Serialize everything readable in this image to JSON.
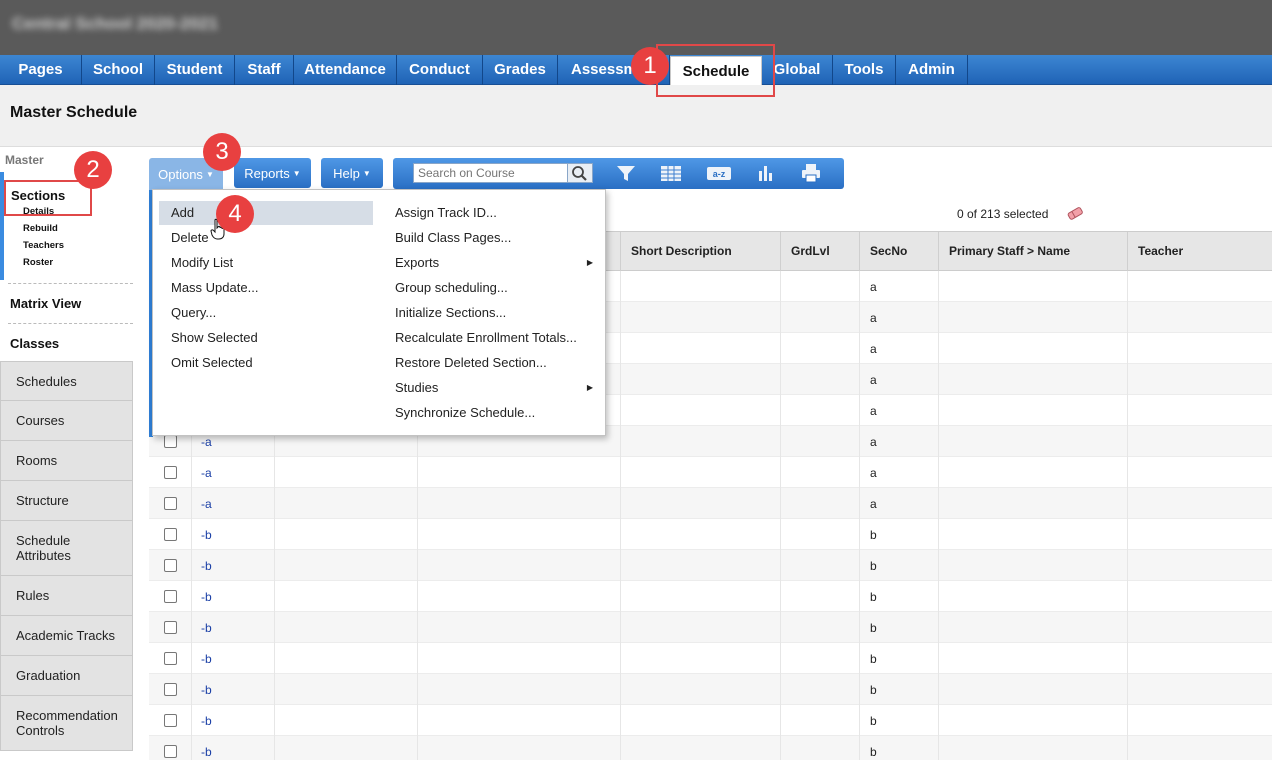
{
  "school_name": "Central School 2020-2021",
  "nav": {
    "tabs": [
      {
        "label": "Pages"
      },
      {
        "label": "School"
      },
      {
        "label": "Student"
      },
      {
        "label": "Staff"
      },
      {
        "label": "Attendance"
      },
      {
        "label": "Conduct"
      },
      {
        "label": "Grades"
      },
      {
        "label": "Assessm"
      },
      {
        "label": "Schedule"
      },
      {
        "label": "Global"
      },
      {
        "label": "Tools"
      },
      {
        "label": "Admin"
      }
    ],
    "active": "Schedule"
  },
  "page_title": "Master Schedule",
  "sidebar": {
    "group_label": "Master",
    "sections_label": "Sections",
    "sections_sub": [
      "Details",
      "Rebuild",
      "Teachers",
      "Roster"
    ],
    "matrix_view": "Matrix View",
    "classes": "Classes",
    "tabs": [
      "Schedules",
      "Courses",
      "Rooms",
      "Structure",
      "Schedule Attributes",
      "Rules",
      "Academic Tracks",
      "Graduation",
      "Recommendation Controls"
    ]
  },
  "toolbar": {
    "options_label": "Options",
    "reports_label": "Reports",
    "help_label": "Help",
    "search_placeholder": "Search on Course",
    "icons": [
      "search-icon",
      "filter-icon",
      "grid-icon",
      "sort-az-icon",
      "chart-icon",
      "print-icon"
    ]
  },
  "selection": {
    "text": "0 of 213 selected"
  },
  "grid": {
    "columns": [
      "Short Description",
      "GrdLvl",
      "SecNo",
      "Primary Staff > Name",
      "Teacher"
    ],
    "rows": [
      {
        "link": "",
        "secno": "a"
      },
      {
        "link": "",
        "secno": "a"
      },
      {
        "link": "",
        "secno": "a"
      },
      {
        "link": "",
        "secno": "a"
      },
      {
        "link": "",
        "secno": "a"
      },
      {
        "link": "-a",
        "secno": "a"
      },
      {
        "link": "-a",
        "secno": "a"
      },
      {
        "link": "-a",
        "secno": "a"
      },
      {
        "link": "-b",
        "secno": "b"
      },
      {
        "link": "-b",
        "secno": "b"
      },
      {
        "link": "-b",
        "secno": "b"
      },
      {
        "link": "-b",
        "secno": "b"
      },
      {
        "link": "-b",
        "secno": "b"
      },
      {
        "link": "-b",
        "secno": "b"
      },
      {
        "link": "-b",
        "secno": "b"
      },
      {
        "link": "-b",
        "secno": "b"
      }
    ]
  },
  "options_menu": {
    "left": [
      "Add",
      "Delete",
      "Modify List",
      "Mass Update...",
      "Query...",
      "Show Selected",
      "Omit Selected"
    ],
    "right": [
      "Assign Track ID...",
      "Build Class Pages...",
      "Exports",
      "Group scheduling...",
      "Initialize Sections...",
      "Recalculate Enrollment Totals...",
      "Restore Deleted Section...",
      "Studies",
      "Synchronize Schedule..."
    ],
    "highlighted": "Add"
  },
  "callouts": [
    "1",
    "2",
    "3",
    "4"
  ],
  "colors": {
    "nav_blue": "#2a6fc4",
    "callout_red": "#e84040"
  }
}
